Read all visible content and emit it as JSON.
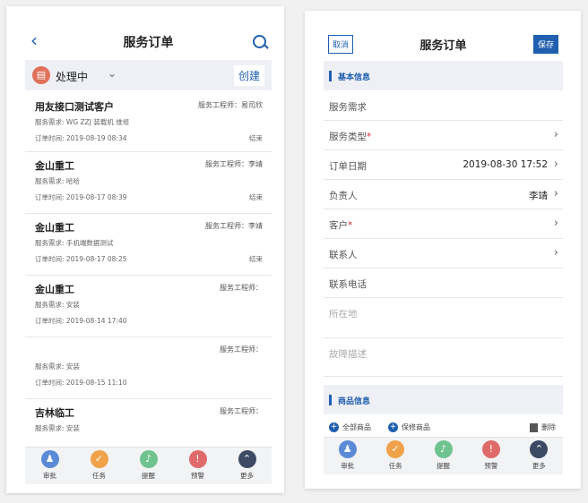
{
  "left": {
    "title": "服务订单",
    "filter": {
      "status_label": "处理中",
      "create_label": "创建"
    },
    "orders": [
      {
        "customer": "用友接口测试客户",
        "engineer": "服务工程师：易司欣",
        "need": "服务需求: WG ZZJ 装载机 维修",
        "time": "订单时间: 2019-08-19 08:34",
        "status": "结束"
      },
      {
        "customer": "金山重工",
        "engineer": "服务工程师：李靖",
        "need": "服务需求: 哈哈",
        "time": "订单时间: 2019-08-17 08:39",
        "status": "结束"
      },
      {
        "customer": "金山重工",
        "engineer": "服务工程师：李靖",
        "need": "服务需求: 手机端数据测试",
        "time": "订单时间: 2019-08-17 08:25",
        "status": "结束"
      },
      {
        "customer": "金山重工",
        "engineer": "服务工程师：",
        "need": "服务需求: 安装",
        "time": "订单时间: 2019-08-14 17:40",
        "status": ""
      },
      {
        "customer": "",
        "engineer": "服务工程师：",
        "need": "服务需求: 安装",
        "time": "订单时间: 2019-08-15 11:10",
        "status": ""
      },
      {
        "customer": "吉林临工",
        "engineer": "服务工程师：",
        "need": "服务需求: 安装",
        "time": "",
        "status": ""
      }
    ]
  },
  "tabs": [
    {
      "label": "审批",
      "icon": "person-icon",
      "color": "#5b8bd6",
      "glyph": "♟"
    },
    {
      "label": "任务",
      "icon": "task-icon",
      "color": "#f0a24a",
      "glyph": "✓"
    },
    {
      "label": "提醒",
      "icon": "bell-icon",
      "color": "#6fc38f",
      "glyph": "♪"
    },
    {
      "label": "预警",
      "icon": "alert-icon",
      "color": "#e06a6a",
      "glyph": "!"
    },
    {
      "label": "更多",
      "icon": "more-icon",
      "color": "#3d4a63",
      "glyph": "⌃"
    }
  ],
  "right": {
    "title": "服务订单",
    "cancel_label": "取消",
    "save_label": "保存",
    "section_basic": "基本信息",
    "section_goods": "商品信息",
    "fields": {
      "demand": "服务需求",
      "type": "服务类型",
      "date": "订单日期",
      "date_value": "2019-08-30 17:52",
      "owner": "负责人",
      "owner_value": "李靖",
      "customer": "客户",
      "contact": "联系人",
      "phone": "联系电话",
      "location": "所在地",
      "fault": "故障描述",
      "required_mark": "*"
    },
    "goods_actions": {
      "all": "全部商品",
      "warranty": "保修商品",
      "delete": "删除"
    }
  }
}
